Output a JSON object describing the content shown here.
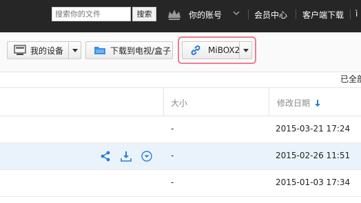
{
  "topbar": {
    "search_placeholder": "搜索你的文件",
    "search_button": "搜索",
    "account_label": "你的账号",
    "links": [
      "会员中心",
      "客户端下载"
    ]
  },
  "toolbar": {
    "my_devices": "我的设备",
    "download_to_tv": "下载到电视/盒子",
    "device_name": "MiBOX2",
    "select_all": "已全部"
  },
  "table": {
    "columns": {
      "size": "大小",
      "modified": "修改日期"
    },
    "rows": [
      {
        "size": "-",
        "modified": "2015-03-21 17:24",
        "highlighted": false
      },
      {
        "size": "-",
        "modified": "2015-02-26 11:51",
        "highlighted": true
      },
      {
        "size": "-",
        "modified": "2015-01-03 17:34",
        "highlighted": false
      }
    ]
  },
  "colors": {
    "accent": "#2b7cd3",
    "highlight_border": "#f07b95",
    "row_highlight": "#eaf3fc",
    "topbar": "#262626"
  }
}
